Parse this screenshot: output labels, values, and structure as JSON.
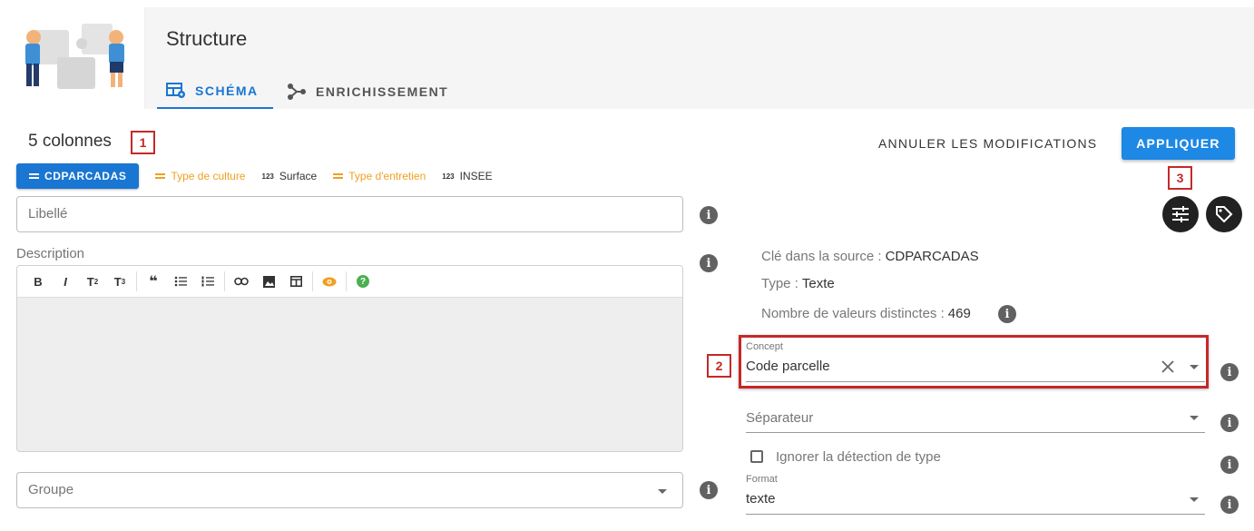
{
  "header": {
    "title": "Structure",
    "tabs": [
      {
        "label": "SCHÉMA",
        "active": true
      },
      {
        "label": "ENRICHISSEMENT",
        "active": false
      }
    ]
  },
  "summary": {
    "column_count": "5 colonnes",
    "badges": [
      "1",
      "2",
      "3"
    ]
  },
  "actions": {
    "cancel_label": "ANNULER LES MODIFICATIONS",
    "apply_label": "APPLIQUER"
  },
  "columns": [
    {
      "name": "CDPARCADAS",
      "kind": "text",
      "icon": "lines-icon",
      "active": true
    },
    {
      "name": "Type de culture",
      "kind": "text",
      "icon": "lines-icon",
      "active": false
    },
    {
      "name": "Surface",
      "kind": "number",
      "icon": "123",
      "active": false
    },
    {
      "name": "Type d'entretien",
      "kind": "text",
      "icon": "lines-icon",
      "active": false
    },
    {
      "name": "INSEE",
      "kind": "number",
      "icon": "123",
      "active": false
    }
  ],
  "form": {
    "label_placeholder": "Libellé",
    "description_label": "Description",
    "group_placeholder": "Groupe"
  },
  "editor_toolbar": [
    "B",
    "I",
    "T2",
    "T3",
    "quote",
    "bullet-list",
    "numbered-list",
    "link",
    "image",
    "table",
    "preview",
    "help"
  ],
  "properties": {
    "source_key_label": "Clé dans la source :",
    "source_key_value": "CDPARCADAS",
    "type_label": "Type :",
    "type_value": "Texte",
    "distinct_label": "Nombre de valeurs distinctes :",
    "distinct_value": "469"
  },
  "concept": {
    "label": "Concept",
    "value": "Code parcelle"
  },
  "separator": {
    "placeholder": "Séparateur"
  },
  "ignore_type_detection": {
    "label": "Ignorer la détection de type",
    "checked": false
  },
  "format": {
    "label": "Format",
    "value": "texte"
  },
  "colors": {
    "accent": "#1976d2",
    "apply_button": "#1e88e5",
    "highlight": "#c62828",
    "text_column": "#f0a020",
    "preview_icon": "#f0a020",
    "help_icon": "#4caf50"
  }
}
